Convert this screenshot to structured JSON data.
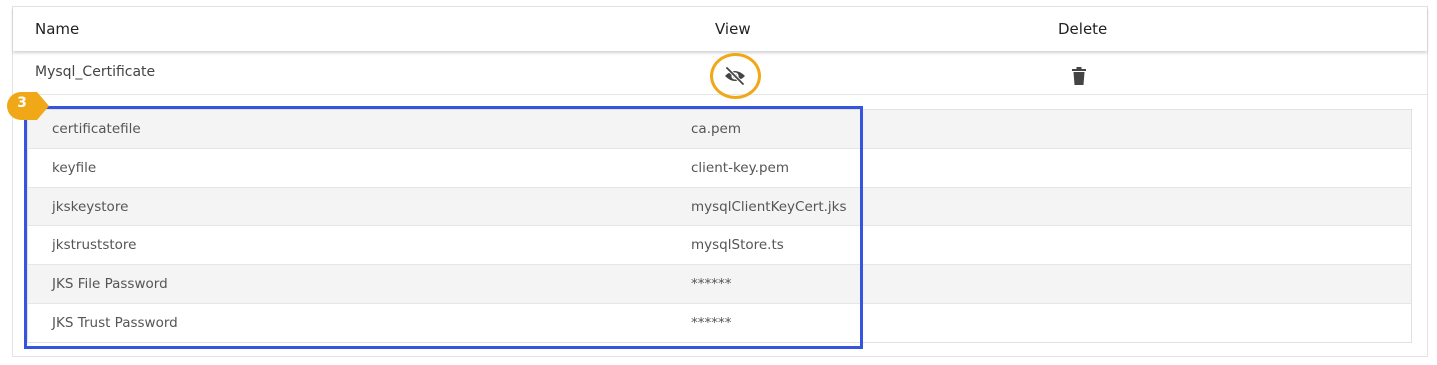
{
  "table": {
    "headers": {
      "name": "Name",
      "view": "View",
      "delete": "Delete"
    },
    "row": {
      "name": "Mysql_Certificate",
      "view_icon": "eye-slash-icon",
      "delete_icon": "trash-icon"
    },
    "details": [
      {
        "key": "certificatefile",
        "value": "ca.pem"
      },
      {
        "key": "keyfile",
        "value": "client-key.pem"
      },
      {
        "key": "jkskeystore",
        "value": "mysqlClientKeyCert.jks"
      },
      {
        "key": "jkstruststore",
        "value": "mysqlStore.ts"
      },
      {
        "key": "JKS File Password",
        "value": "******"
      },
      {
        "key": "JKS Trust Password",
        "value": "******"
      }
    ]
  },
  "annotation": {
    "step_number": "3",
    "box_color": "#3555e0",
    "circle_color": "#f0a818",
    "badge_color": "#f0a818"
  }
}
